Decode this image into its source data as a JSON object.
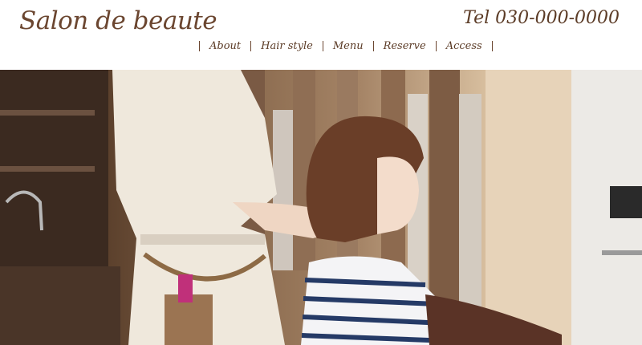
{
  "header": {
    "logo": "Salon de beaute",
    "tel": "Tel 030-000-0000"
  },
  "nav": {
    "items": [
      {
        "label": "About"
      },
      {
        "label": "Hair style"
      },
      {
        "label": "Menu"
      },
      {
        "label": "Reserve"
      },
      {
        "label": "Access"
      }
    ]
  },
  "colors": {
    "brand_brown": "#5b3b26",
    "header_bg": "#ffffff"
  }
}
